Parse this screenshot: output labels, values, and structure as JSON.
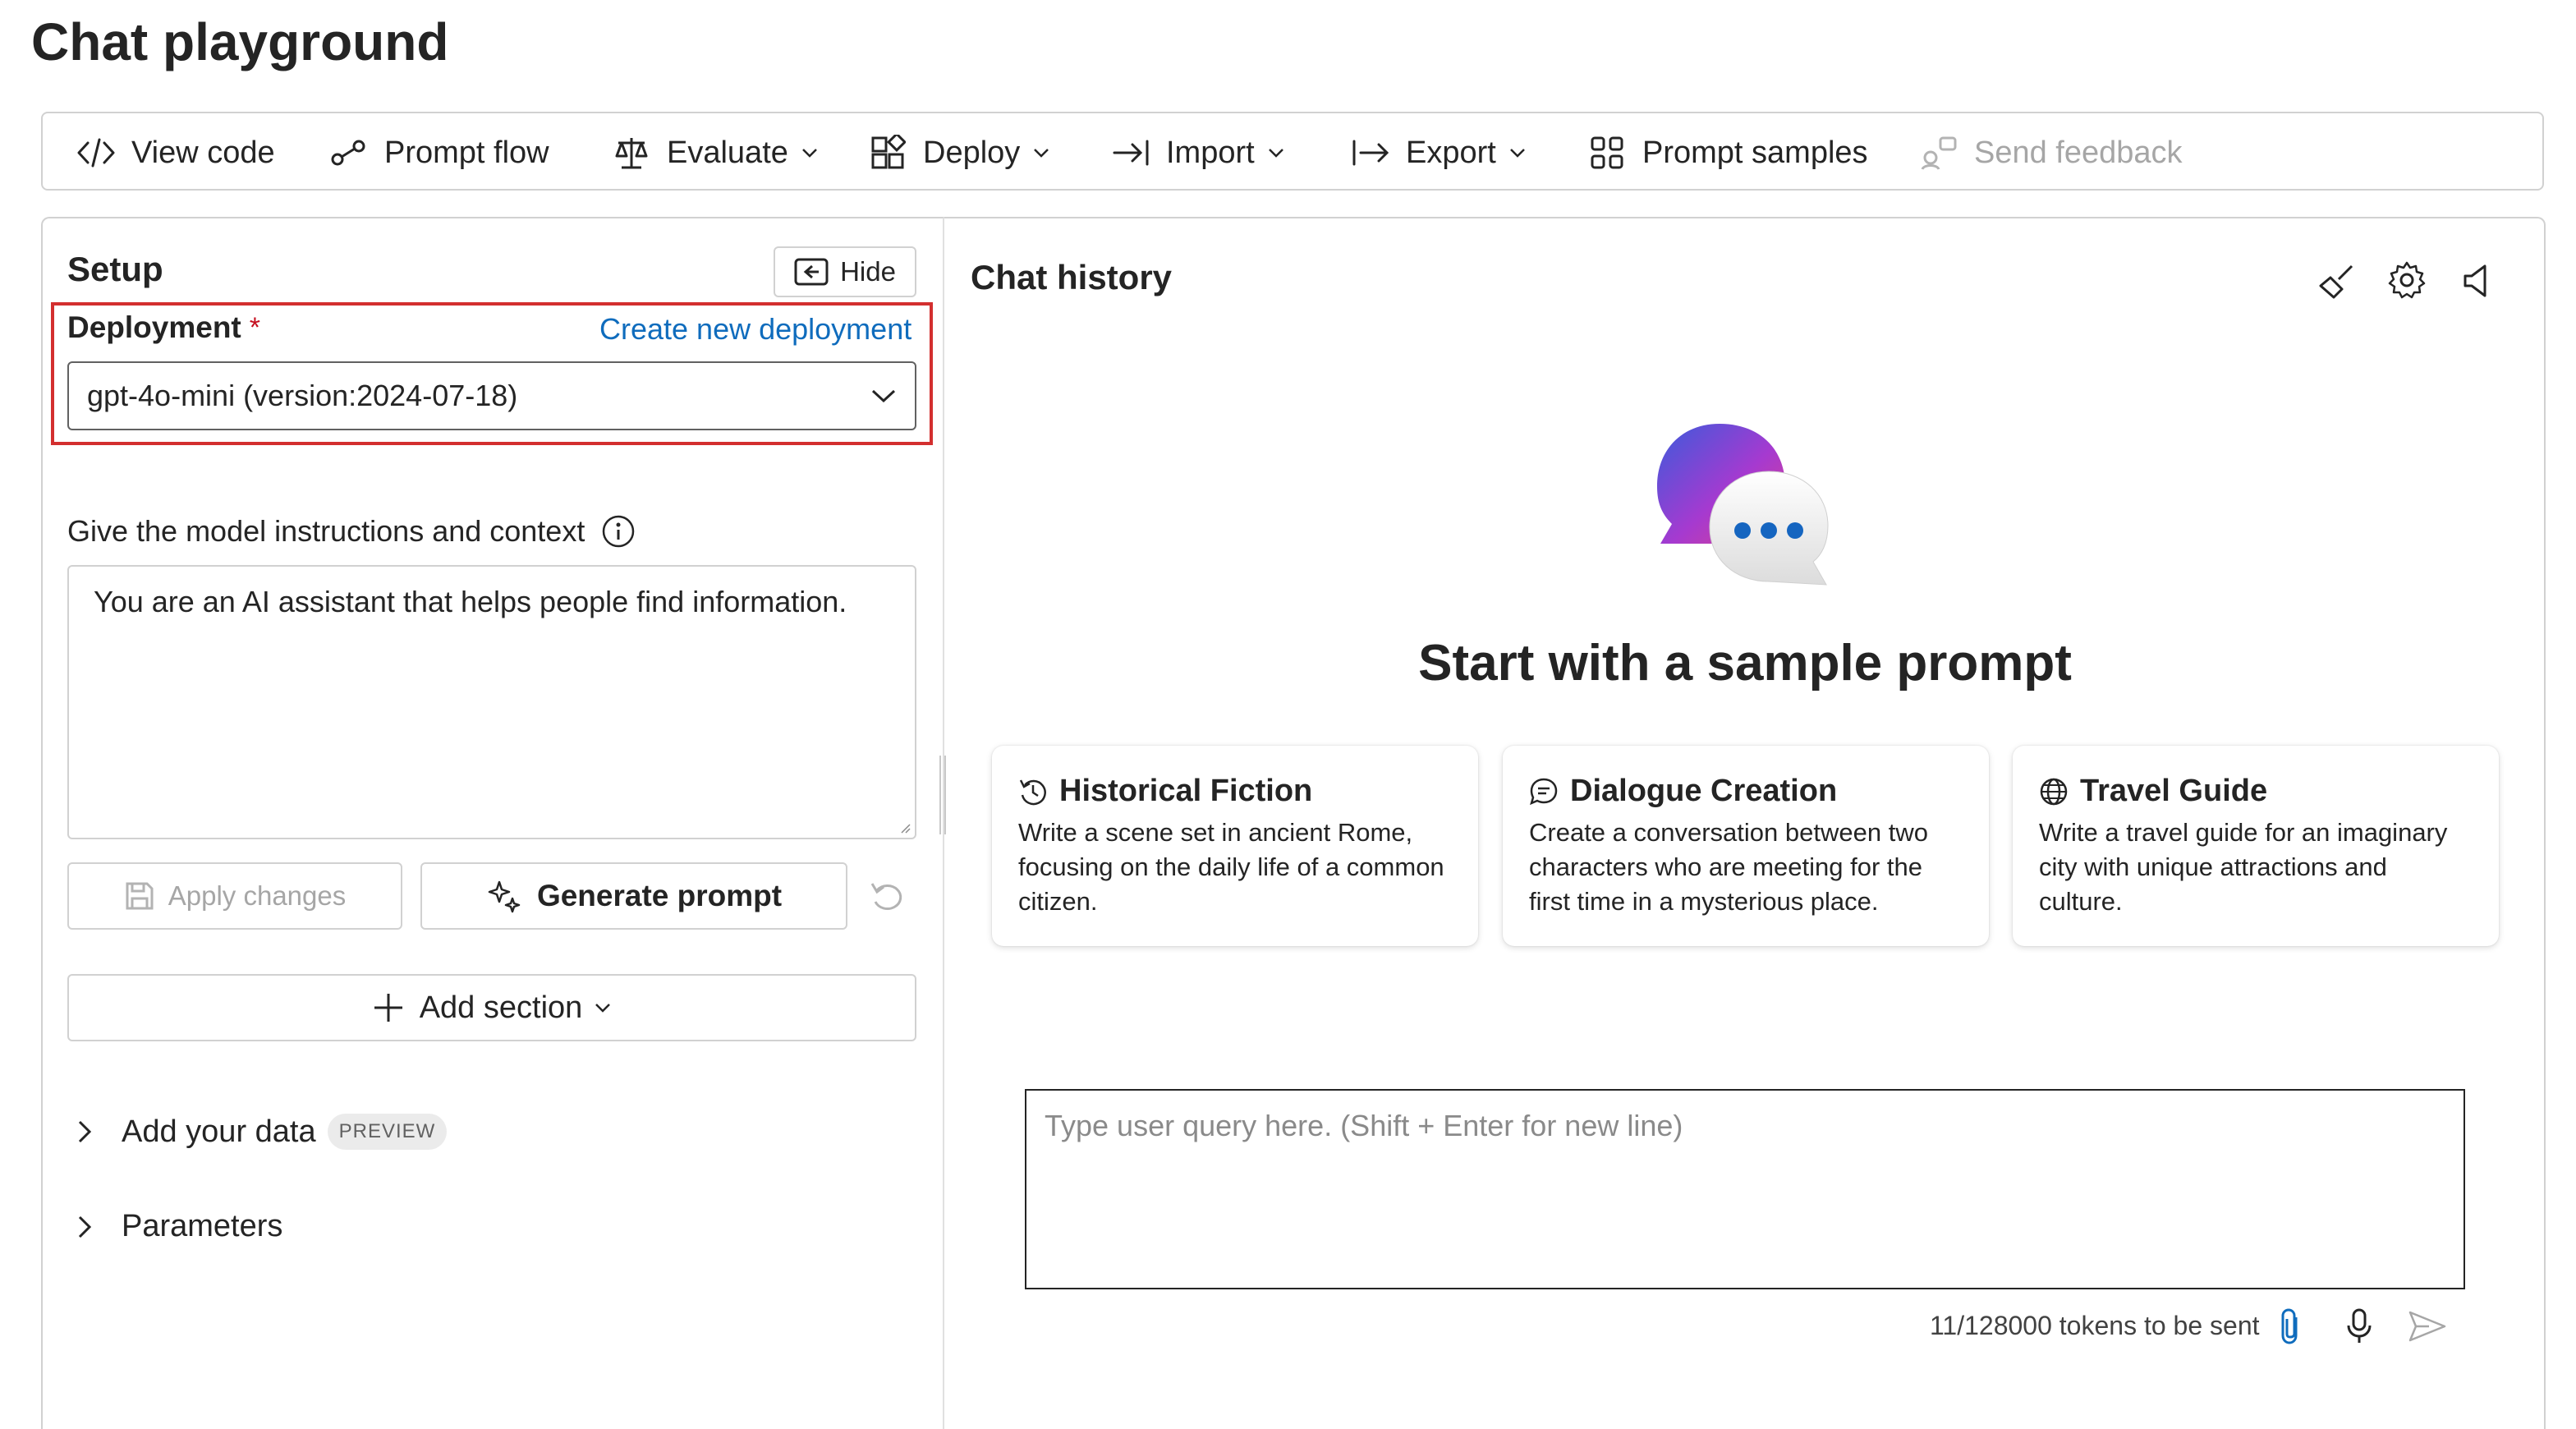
{
  "page": {
    "title": "Chat playground"
  },
  "toolbar": {
    "view_code": "View code",
    "prompt_flow": "Prompt flow",
    "evaluate": "Evaluate",
    "deploy": "Deploy",
    "import": "Import",
    "export": "Export",
    "prompt_samples": "Prompt samples",
    "send_feedback": "Send feedback"
  },
  "setup": {
    "title": "Setup",
    "hide_label": "Hide",
    "deployment_label": "Deployment",
    "required_mark": "*",
    "create_link": "Create new deployment",
    "deployment_value": "gpt-4o-mini (version:2024-07-18)",
    "instructions_label": "Give the model instructions and context",
    "instructions_value": "You are an AI assistant that helps people find information.",
    "apply_label": "Apply changes",
    "generate_label": "Generate prompt",
    "add_section_label": "Add section",
    "add_data_label": "Add your data",
    "preview_badge": "PREVIEW",
    "parameters_label": "Parameters"
  },
  "chat": {
    "title": "Chat history",
    "heading": "Start with a sample prompt",
    "cards": [
      {
        "icon": "history-icon",
        "title": "Historical Fiction",
        "desc": "Write a scene set in ancient Rome, focusing on the daily life of a common citizen."
      },
      {
        "icon": "chat-bubble-icon",
        "title": "Dialogue Creation",
        "desc": "Create a conversation between two characters who are meeting for the first time in a mysterious place."
      },
      {
        "icon": "globe-icon",
        "title": "Travel Guide",
        "desc": "Write a travel guide for an imaginary city with unique attractions and culture."
      }
    ],
    "input_placeholder": "Type user query here. (Shift + Enter for new line)",
    "token_count": "11/128000 tokens to be sent"
  },
  "colors": {
    "accent": "#0f6cbd",
    "highlight_border": "#d32f2f",
    "required": "#c50f1f"
  }
}
